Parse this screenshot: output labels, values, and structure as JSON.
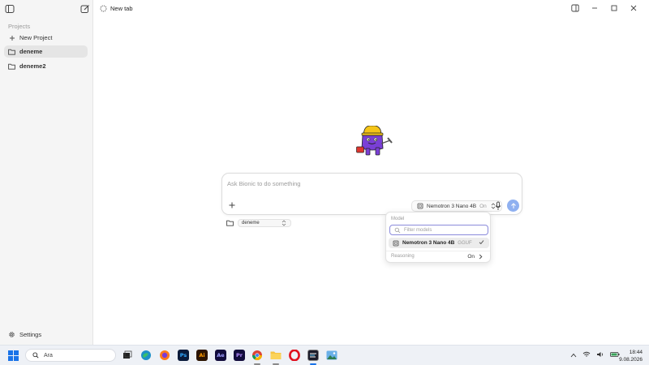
{
  "sidebar": {
    "heading": "Projects",
    "new_project": "New Project",
    "items": [
      {
        "label": "deneme",
        "active": true
      },
      {
        "label": "deneme2",
        "active": false
      }
    ],
    "settings": "Settings"
  },
  "tab": {
    "title": "New tab"
  },
  "composer": {
    "placeholder": "Ask Bionic to do something",
    "model_name": "Nemotron 3 Nano 4B",
    "model_reasoning": "On"
  },
  "project_select": {
    "value": "deneme"
  },
  "model_dropdown": {
    "heading": "Model",
    "filter_placeholder": "Filter models",
    "option": {
      "name": "Nemotron 3 Nano 4B",
      "format": "GGUF",
      "selected": true
    },
    "reasoning_label": "Reasoning",
    "reasoning_value": "On"
  },
  "taskbar": {
    "search_text": "Ara",
    "apps": [
      "task-view",
      "edge",
      "firefox",
      "photoshop",
      "illustrator",
      "after-effects",
      "premiere",
      "chrome",
      "file-explorer",
      "opera",
      "bionic",
      "photos"
    ],
    "ps_label": "Ps",
    "ai_label": "Ai",
    "ae_label": "Ae",
    "pr_label": "Pr",
    "time": "18:44",
    "date": "9.08.2026"
  },
  "colors": {
    "accent": "#8fb0f0",
    "filter_border": "#8a8adb",
    "sidebar_bg": "#f5f5f5",
    "taskbar_bg": "#eef1f6"
  }
}
